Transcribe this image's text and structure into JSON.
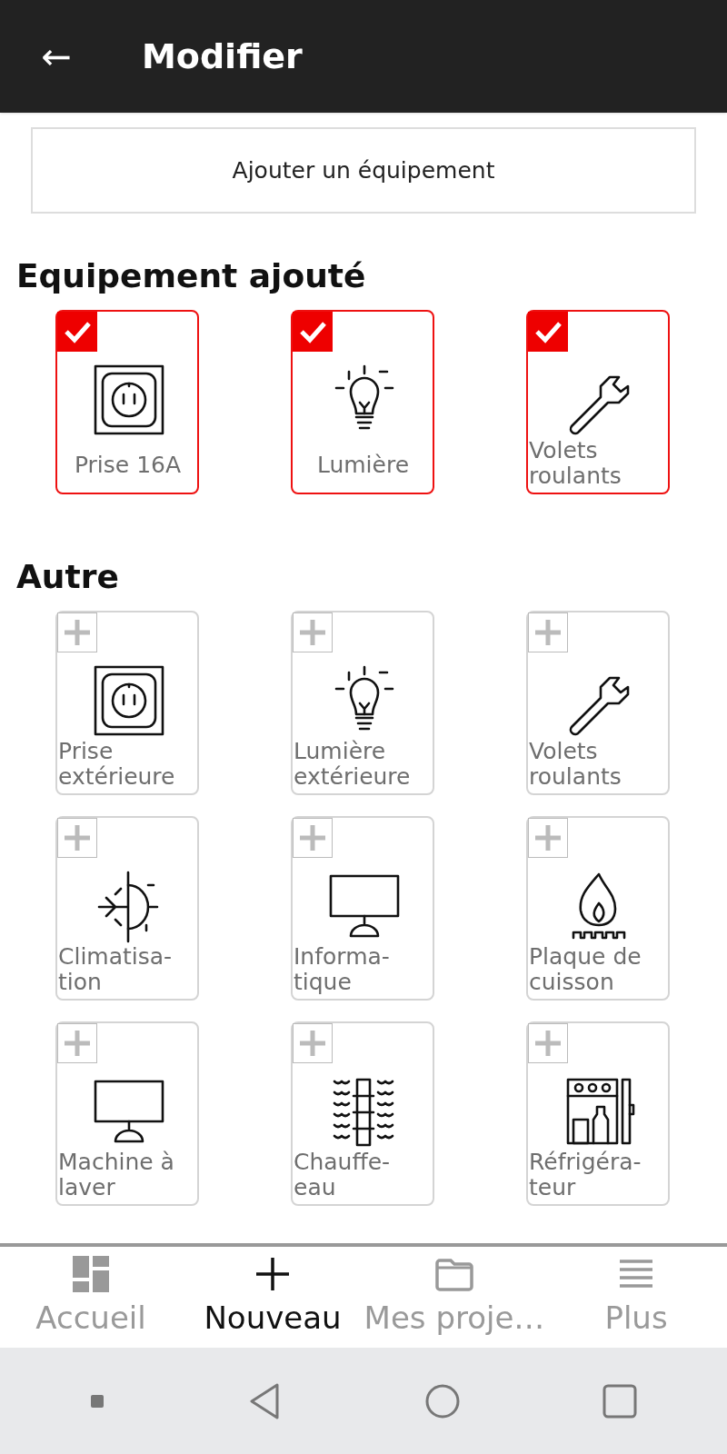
{
  "header": {
    "back_icon": "←",
    "title": "Modifier"
  },
  "add_button": "Ajouter un équipement",
  "sections": [
    {
      "title": "Equipement ajouté",
      "items": [
        {
          "kind": "socket",
          "label_lines": [
            "Prise 16A"
          ],
          "added": true
        },
        {
          "kind": "bulb",
          "label_lines": [
            "Lumière"
          ],
          "added": true
        },
        {
          "kind": "wrench",
          "label_lines": [
            "Volets",
            "roulants"
          ],
          "added": true
        }
      ]
    },
    {
      "title": "Autre",
      "items": [
        {
          "kind": "socket",
          "label_lines": [
            "Prise",
            "extérieure"
          ],
          "added": false
        },
        {
          "kind": "bulb",
          "label_lines": [
            "Lumière",
            "extérieure"
          ],
          "added": false
        },
        {
          "kind": "wrench",
          "label_lines": [
            "Volets",
            "roulants"
          ],
          "added": false
        },
        {
          "kind": "climate",
          "label_lines": [
            "Climatisa-",
            "tion"
          ],
          "added": false
        },
        {
          "kind": "monitor",
          "label_lines": [
            "Informa-",
            "tique"
          ],
          "added": false
        },
        {
          "kind": "flame",
          "label_lines": [
            "Plaque de",
            "cuisson"
          ],
          "added": false
        },
        {
          "kind": "monitor",
          "label_lines": [
            "Machine à",
            "laver"
          ],
          "added": false
        },
        {
          "kind": "heater",
          "label_lines": [
            "Chauffe-",
            "eau"
          ],
          "added": false
        },
        {
          "kind": "fridge",
          "label_lines": [
            "Réfrigéra-",
            "teur"
          ],
          "added": false
        }
      ]
    }
  ],
  "bottom_nav": [
    {
      "kind": "grid",
      "label": "Accueil",
      "selected": false
    },
    {
      "kind": "plus",
      "label": "Nouveau",
      "selected": true
    },
    {
      "kind": "folder",
      "label": "Mes proje…",
      "selected": false
    },
    {
      "kind": "lines",
      "label": "Plus",
      "selected": false
    }
  ]
}
